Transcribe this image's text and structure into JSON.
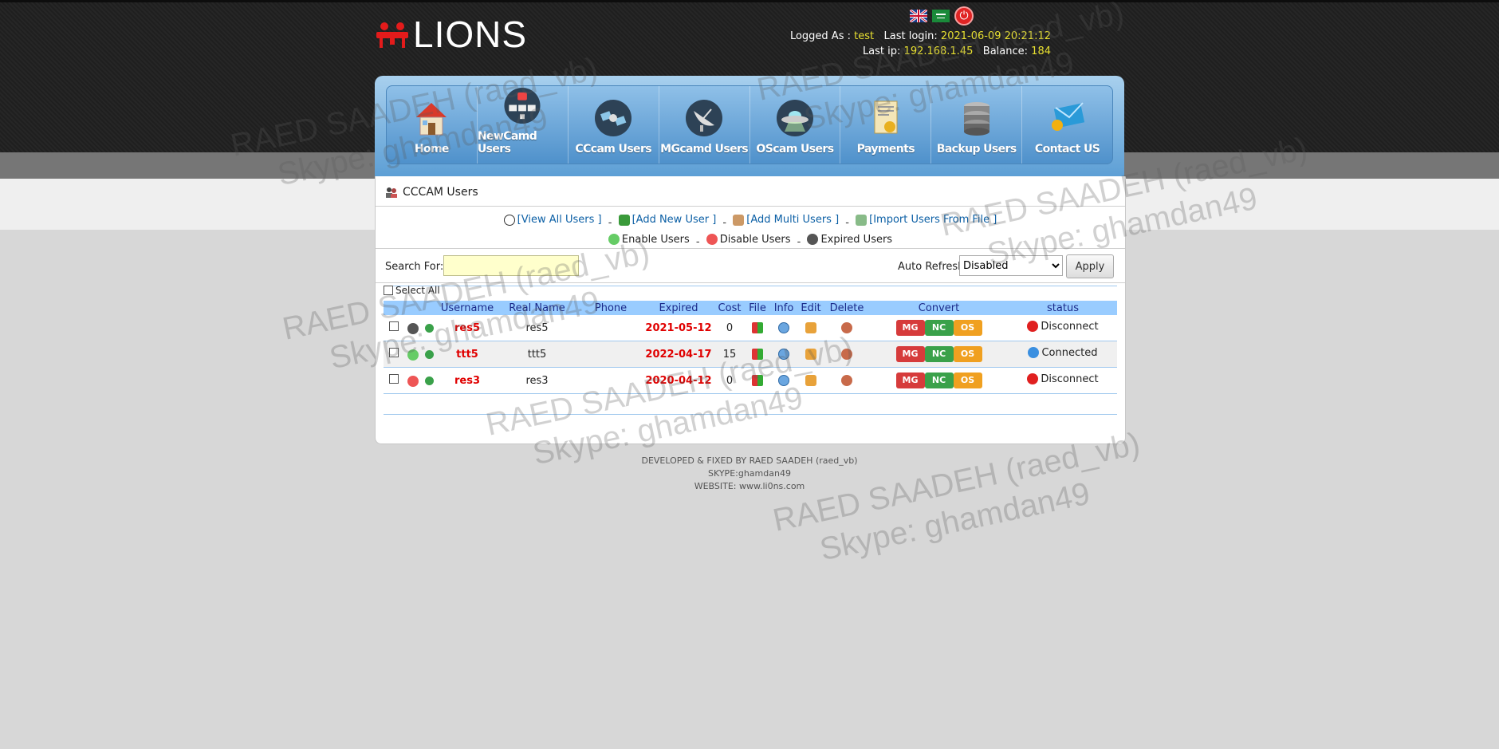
{
  "logo": {
    "text": "LIONS"
  },
  "header": {
    "logged_as_label": "Logged As :",
    "logged_as_value": "test",
    "last_login_label": "Last login:",
    "last_login_value": "2021-06-09 20:21:12",
    "last_ip_label": "Last ip:",
    "last_ip_value": "192.168.1.45",
    "balance_label": "Balance:",
    "balance_value": "184"
  },
  "nav": {
    "items": [
      {
        "label": "Home",
        "icon": "house-icon"
      },
      {
        "label": "NewCamd Users",
        "icon": "network-icon"
      },
      {
        "label": "CCcam Users",
        "icon": "satellite-icon"
      },
      {
        "label": "MGcamd Users",
        "icon": "dish-icon"
      },
      {
        "label": "OScam Users",
        "icon": "ufo-icon"
      },
      {
        "label": "Payments",
        "icon": "invoice-icon"
      },
      {
        "label": "Backup Users",
        "icon": "database-icon"
      },
      {
        "label": "Contact US",
        "icon": "mail-icon"
      }
    ]
  },
  "panel": {
    "title": "CCCAM Users",
    "links": {
      "view_all": "[View All Users ]",
      "add_new": "[Add New User ]",
      "add_multi": "[Add Multi Users ]",
      "import": "[Import Users From File ]",
      "enable": "Enable Users",
      "disable": "Disable Users",
      "expired": "Expired Users",
      "sep": "-"
    },
    "search_label": "Search For:",
    "search_value": "",
    "auto_refresh_label": "Auto Refresh:",
    "auto_refresh_value": "Disabled",
    "apply_label": "Apply",
    "select_all_label": "Select All"
  },
  "table": {
    "headers": [
      "Username",
      "Real Name",
      "Phone",
      "Expired",
      "Cost",
      "File",
      "Info",
      "Edit",
      "Delete",
      "Convert",
      "status"
    ],
    "rows": [
      {
        "username": "res5",
        "realname": "res5",
        "phone": "",
        "expired": "2021-05-12",
        "cost": "0",
        "status": "Disconnect",
        "status_color": "#e02020"
      },
      {
        "username": "ttt5",
        "realname": "ttt5",
        "phone": "",
        "expired": "2022-04-17",
        "cost": "15",
        "status": "Connected",
        "status_color": "#3a8fe0"
      },
      {
        "username": "res3",
        "realname": "res3",
        "phone": "",
        "expired": "2020-04-12",
        "cost": "0",
        "status": "Disconnect",
        "status_color": "#e02020"
      }
    ],
    "convert_labels": {
      "mg": "MG",
      "nc": "NC",
      "os": "OS"
    }
  },
  "footer": {
    "line1": "DEVELOPED & FIXED BY RAED SAADEH (raed_vb)",
    "line2": "SKYPE:ghamdan49",
    "line3": "WEBSITE: www.li0ns.com"
  },
  "watermark": {
    "line1": "RAED SAADEH (raed_vb)",
    "line2": "Skype: ghamdan49"
  }
}
